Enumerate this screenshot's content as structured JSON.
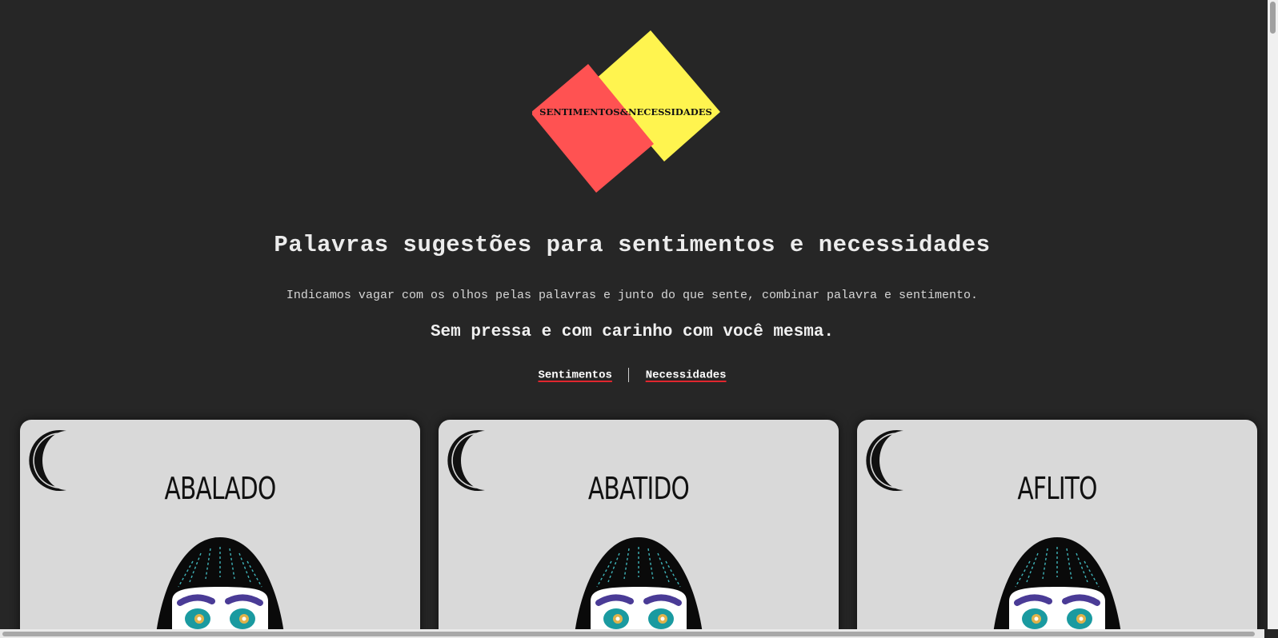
{
  "logo": {
    "text_left": "SENTIMENTOS",
    "amp": "&",
    "text_right": "NECESSIDADES",
    "colors": {
      "red": "#ff5252",
      "yellow": "#fff44f"
    }
  },
  "headline": "Palavras sugestões para sentimentos e necessidades",
  "subtitle": "Indicamos vagar com os olhos pelas palavras e junto do que sente, combinar palavra e sentimento.",
  "tagline": "Sem pressa e com carinho com você mesma.",
  "nav": {
    "link_1": "Sentimentos",
    "link_2": "Necessidades"
  },
  "cards": [
    {
      "word": "ABALADO",
      "icon": "moon-icon"
    },
    {
      "word": "ABATIDO",
      "icon": "moon-icon"
    },
    {
      "word": "AFLITO",
      "icon": "moon-icon"
    }
  ]
}
